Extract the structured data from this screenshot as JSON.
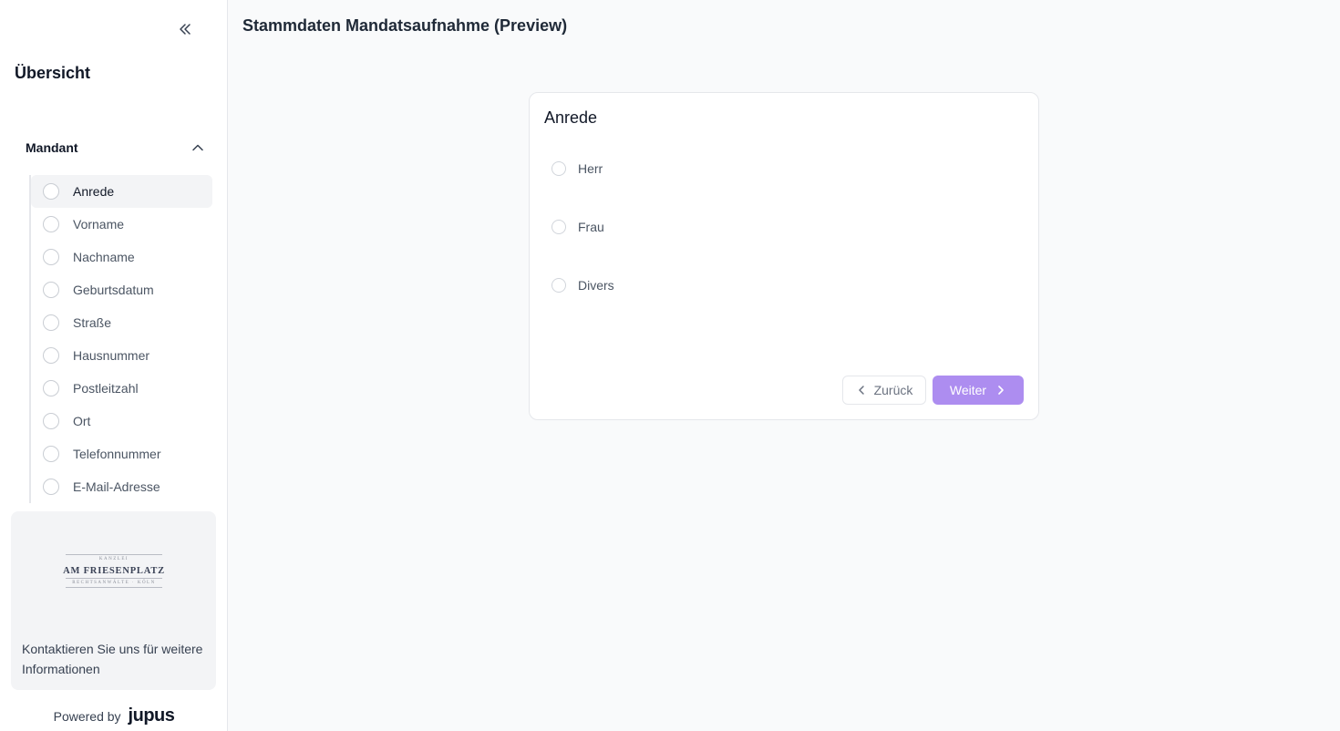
{
  "sidebar": {
    "overview_title": "Übersicht",
    "section": {
      "label": "Mandant",
      "expanded": true
    },
    "steps": [
      {
        "label": "Anrede",
        "active": true
      },
      {
        "label": "Vorname"
      },
      {
        "label": "Nachname"
      },
      {
        "label": "Geburtsdatum"
      },
      {
        "label": "Straße"
      },
      {
        "label": "Hausnummer"
      },
      {
        "label": "Postleitzahl"
      },
      {
        "label": "Ort"
      },
      {
        "label": "Telefonnummer"
      },
      {
        "label": "E-Mail-Adresse"
      }
    ],
    "contact": {
      "logo_main": "AM FRIESENPLATZ",
      "logo_top": "KANZLEI",
      "logo_bottom": "RECHTSANWÄLTE · KÖLN",
      "text": "Kontaktieren Sie uns für weitere Informationen"
    },
    "powered_by": "Powered by",
    "brand": "jupus"
  },
  "header": {
    "title": "Stammdaten Mandatsaufnahme (Preview)"
  },
  "card": {
    "title": "Anrede",
    "options": [
      "Herr",
      "Frau",
      "Divers"
    ],
    "back_label": "Zurück",
    "next_label": "Weiter"
  },
  "colors": {
    "accent": "#ad8df0",
    "background": "#f9fafb",
    "sidebar": "#ffffff"
  }
}
